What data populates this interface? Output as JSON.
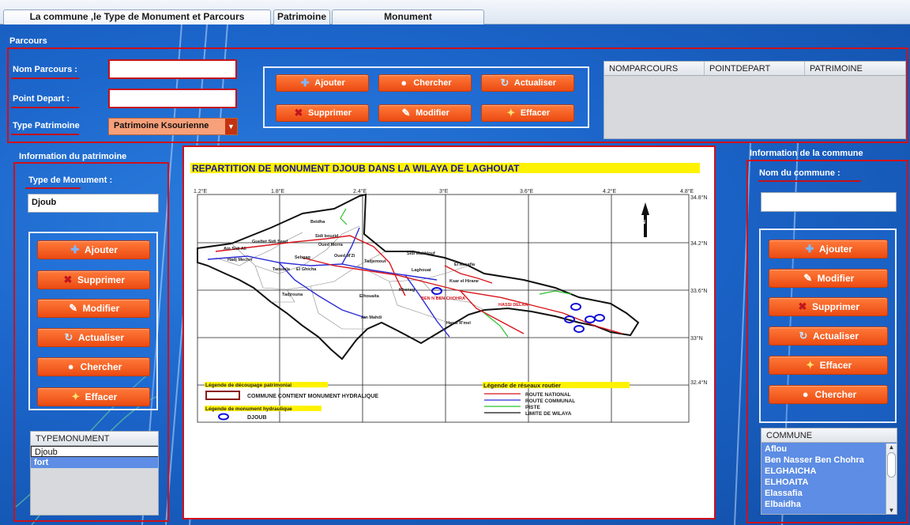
{
  "tabs": [
    {
      "label": "La commune ,le  Type de Monument et Parcours Touristique",
      "active": true
    },
    {
      "label": "Patrimoine",
      "active": false
    },
    {
      "label": "Monument",
      "active": false
    }
  ],
  "parcours": {
    "section_title": "Parcours",
    "nom_label": "Nom Parcours :",
    "nom_value": "",
    "point_label": "Point Depart   :",
    "point_value": "",
    "type_label": "Type Patrimoine",
    "type_value": "Patrimoine Ksourienne",
    "buttons": {
      "ajouter": "Ajouter",
      "chercher": "Chercher",
      "actualiser": "Actualiser",
      "supprimer": "Supprimer",
      "modifier": "Modifier",
      "effacer": "Effacer"
    },
    "table_headers": [
      "NOMPARCOURS",
      "POINTDEPART",
      "PATRIMOINE"
    ]
  },
  "patrimoine": {
    "section_title": "Information du patrimoine",
    "type_label": "Type de Monument  :",
    "type_value": "Djoub",
    "buttons": {
      "ajouter": "Ajouter",
      "supprimer": "Supprimer",
      "modifier": "Modifier",
      "actualiser": "Actualiser",
      "chercher": "Chercher",
      "effacer": "Effacer"
    },
    "list_header": "TYPEMONUMENT",
    "list_items": [
      "Djoub",
      "fort"
    ]
  },
  "map": {
    "title": "REPARTITION DE MONUMENT DJOUB DANS LA WILAYA DE LAGHOUAT",
    "lon_ticks": [
      "1.2°E",
      "1.8°E",
      "2.4°E",
      "3°E",
      "3.6°E",
      "4.2°E",
      "4.8°E"
    ],
    "lat_ticks": [
      "34.8°N",
      "34.2°N",
      "33.6°N",
      "33°N",
      "32.4°N"
    ],
    "places": [
      "Beidha",
      "Gueltet Sidi Saad",
      "Sidi bouzid",
      "Oued Morra",
      "Ain Sidi Ali",
      "Hadj Mechri",
      "Oued M'Zi",
      "Tadjemout",
      "Sidi Makhlouf",
      "El Assafia",
      "Sebgag",
      "Taouiala",
      "El Ghicha",
      "Laghouat",
      "Ksar el Hirane",
      "Tadjrouna",
      "Elhouaita",
      "Kheneg",
      "BEN N BEN CHOHRA",
      "HASSI DELAA",
      "Ain Mahdi",
      "Hassi R'mel"
    ],
    "legend1_title": "Légende de découpage patrimonial",
    "legend1_item": "COMMUNE CONTIENT MONUMENT HYDRALIQUE",
    "legend2_title": "Légende de monument hydraulique",
    "legend2_item": "DJOUB",
    "legend3_title": "Légende de réseaux routier",
    "roads": [
      "ROUTE NATIONAL",
      "ROUTE COMMUNAL",
      "PISTE",
      "LIMITE DE WILAYA"
    ],
    "colors": {
      "route_national": "#d8141b",
      "route_communal": "#2b2bd6",
      "piste": "#29c22b",
      "limite": "#111111",
      "djoub": "#1010d8"
    }
  },
  "commune": {
    "section_title": "Information de la commune",
    "nom_label": "Nom du commune :",
    "nom_value": "",
    "buttons": {
      "ajouter": "Ajouter",
      "modifier": "Modifier",
      "supprimer": "Supprimer",
      "actualiser": "Actualiser",
      "effacer": "Effacer",
      "chercher": "Chercher"
    },
    "list_header": "COMMUNE",
    "list_items": [
      "Aflou",
      "Ben Nasser Ben Chohra",
      "ELGHAICHA",
      "ELHOAITA",
      "Elassafia",
      "Elbaidha"
    ]
  },
  "icons": {
    "ajouter": "plus-icon",
    "chercher": "magnifier-icon",
    "actualiser": "refresh-icon",
    "supprimer": "delete-x-icon",
    "modifier": "pencil-icon",
    "effacer": "broom-icon"
  },
  "theme": {
    "accent": "#ec4b12",
    "frame": "#d0101a",
    "background": "#1b64c9"
  }
}
